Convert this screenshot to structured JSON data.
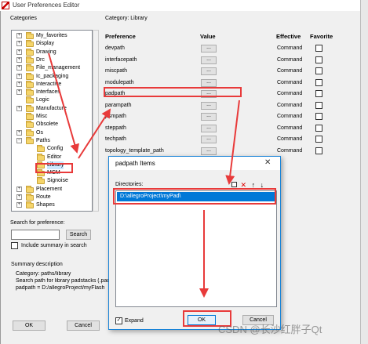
{
  "window": {
    "title": "User Preferences Editor"
  },
  "categories": {
    "label": "Categories",
    "items": [
      {
        "label": "My_favorites",
        "expander": "+"
      },
      {
        "label": "Display",
        "expander": "+"
      },
      {
        "label": "Drawing",
        "expander": "+"
      },
      {
        "label": "Drc",
        "expander": "+"
      },
      {
        "label": "File_management",
        "expander": "+"
      },
      {
        "label": "Ic_packaging",
        "expander": "+"
      },
      {
        "label": "Interactive",
        "expander": "+"
      },
      {
        "label": "Interfaces",
        "expander": "+"
      },
      {
        "label": "Logic",
        "expander": ""
      },
      {
        "label": "Manufacture",
        "expander": "+"
      },
      {
        "label": "Misc",
        "expander": ""
      },
      {
        "label": "Obsolete",
        "expander": ""
      },
      {
        "label": "Os",
        "expander": "+"
      },
      {
        "label": "Paths",
        "expander": "−"
      },
      {
        "label": "Config",
        "expander": ""
      },
      {
        "label": "Editor",
        "expander": ""
      },
      {
        "label": "Library",
        "expander": ""
      },
      {
        "label": "MCM",
        "expander": ""
      },
      {
        "label": "Signoise",
        "expander": ""
      },
      {
        "label": "Placement",
        "expander": "+"
      },
      {
        "label": "Route",
        "expander": "+"
      },
      {
        "label": "Shapes",
        "expander": "+"
      }
    ]
  },
  "search": {
    "label": "Search for preference:",
    "button": "Search",
    "include_summary": "Include summary in search"
  },
  "summary": {
    "label": "Summary description",
    "lines": [
      "Category: paths/library",
      "Search path for library padstacks (.pad",
      "padpath = D:/allegroProject/myFlash"
    ]
  },
  "buttons": {
    "ok": "OK",
    "cancel": "Cancel"
  },
  "table": {
    "category": "Category:  Library",
    "headers": {
      "preference": "Preference",
      "value": "Value",
      "effective": "Effective",
      "favorite": "Favorite"
    },
    "value_button": "...",
    "rows": [
      {
        "name": "devpath",
        "effective": "Command"
      },
      {
        "name": "interfacepath",
        "effective": "Command"
      },
      {
        "name": "miscpath",
        "effective": "Command"
      },
      {
        "name": "modulepath",
        "effective": "Command"
      },
      {
        "name": "padpath",
        "effective": "Command"
      },
      {
        "name": "parampath",
        "effective": "Command"
      },
      {
        "name": "psmpath",
        "effective": "Command"
      },
      {
        "name": "steppath",
        "effective": "Command"
      },
      {
        "name": "techpath",
        "effective": "Command"
      },
      {
        "name": "topology_template_path",
        "effective": "Command"
      }
    ]
  },
  "dialog": {
    "title": "padpath Items",
    "close": "✕",
    "directories_label": "Directories:",
    "tools": "✕ 🡅 🡇",
    "items": [
      "D:\\allegroProject\\myPad\\"
    ],
    "expand": "Expand",
    "ok": "OK",
    "cancel": "Cancel"
  },
  "watermark": "CSDN @长沙红胖子Qt",
  "colors": {
    "annotation_red": "#e83a3a",
    "selection_blue": "#0078d7"
  }
}
